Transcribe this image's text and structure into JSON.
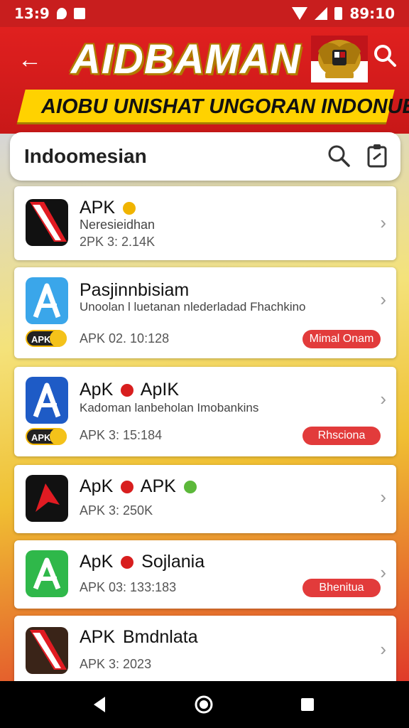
{
  "status_bar": {
    "time": "13:9",
    "clock": "89:10"
  },
  "header": {
    "title": "AIDBAMAN",
    "banner": "AIOBU UNISHAT UNGORAN INDONUESIIA!"
  },
  "search": {
    "title": "Indoomesian"
  },
  "apps": [
    {
      "name": "APK",
      "sub": "Neresieidhan",
      "meta": "2PK 3:  2.14K"
    },
    {
      "name": "Pasjinnbisiam",
      "sub": "Unoolan l luetanan nlederladad Fhachkino",
      "badge": "APK",
      "meta": "APK 02.  10:128",
      "action": "Mimal Onam"
    },
    {
      "name_a": "ApK",
      "name_b": "ApIK",
      "sub": "Kadoman lanbeholan Imobankins",
      "badge": "APK",
      "meta": "APK 3:  15:184",
      "action": "Rhsciona"
    },
    {
      "name_a": "ApK",
      "name_b": "APK",
      "meta": "APK 3:   250K"
    },
    {
      "name_a": "ApK",
      "name_b": "Sojlania",
      "meta": "APK 03:  133:183",
      "action": "Bhenitua"
    },
    {
      "name_a": "APK",
      "name_b": "Bmdnlata",
      "meta": "APK 3:  2023"
    }
  ],
  "colors": {
    "brand_red": "#d92020",
    "accent_yellow": "#ffd200",
    "pill_red": "#e23b3b"
  },
  "icons": [
    "back-arrow-icon",
    "emblem-icon",
    "search-icon",
    "clipboard-icon",
    "chevron-right-icon"
  ]
}
